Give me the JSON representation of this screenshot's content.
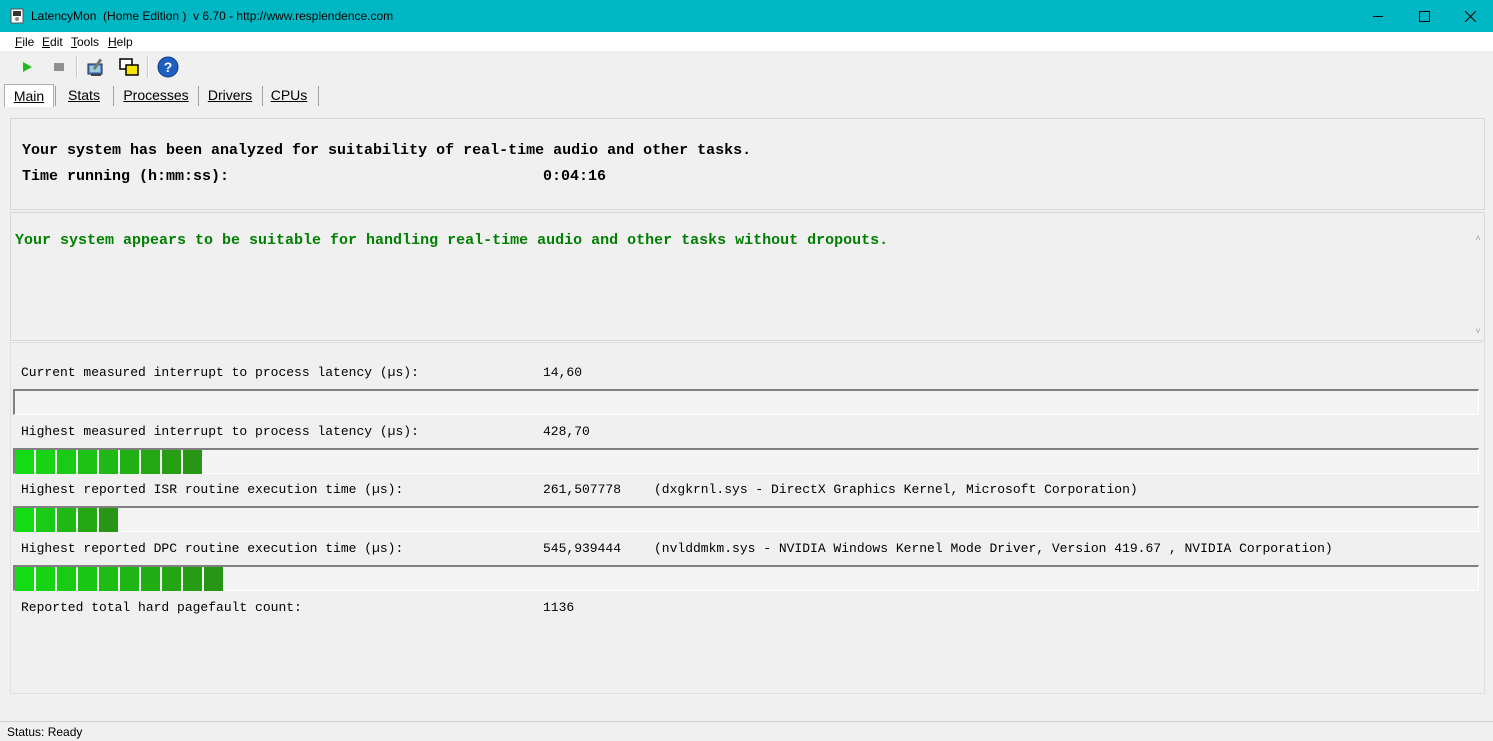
{
  "window": {
    "title": "LatencyMon  (Home Edition )  v 6.70 - http://www.resplendence.com",
    "titlebar_color": "#00b7c3"
  },
  "menu": {
    "items": [
      {
        "label": "File",
        "accel": "F",
        "rest": "ile"
      },
      {
        "label": "Edit",
        "accel": "E",
        "rest": "dit"
      },
      {
        "label": "Tools",
        "accel": "T",
        "rest": "ools"
      },
      {
        "label": "Help",
        "accel": "H",
        "rest": "elp"
      }
    ]
  },
  "toolbar": {
    "icons": [
      "play-icon",
      "stop-icon",
      "computer-tools-icon",
      "windows-overlap-icon",
      "help-icon"
    ]
  },
  "tabs": [
    {
      "label": "Main",
      "active": true
    },
    {
      "label": "Stats",
      "active": false
    },
    {
      "label": "Processes",
      "active": false
    },
    {
      "label": "Drivers",
      "active": false
    },
    {
      "label": "CPUs",
      "active": false
    }
  ],
  "summary": {
    "analyzed": "Your system has been analyzed for suitability of real-time audio and other tasks.",
    "time_label": "Time running (h:mm:ss):",
    "time_value": "0:04:16"
  },
  "conclusion": {
    "text": "Your system appears to be suitable for handling real-time audio and other tasks without dropouts.",
    "color": "#008000"
  },
  "metrics": {
    "current_latency": {
      "label": "Current measured interrupt to process latency (µs):",
      "value": "14,60",
      "segments": 0
    },
    "highest_latency": {
      "label": "Highest measured interrupt to process latency (µs):",
      "value": "428,70",
      "segments": 9
    },
    "isr": {
      "label": "Highest reported ISR routine execution time (µs):",
      "value": "261,507778",
      "detail": "(dxgkrnl.sys - DirectX Graphics Kernel, Microsoft Corporation)",
      "segments": 5
    },
    "dpc": {
      "label": "Highest reported DPC routine execution time (µs):",
      "value": "545,939444",
      "detail": "(nvlddmkm.sys - NVIDIA Windows Kernel Mode Driver, Version 419.67 , NVIDIA Corporation)",
      "segments": 10
    },
    "pagefault": {
      "label": "Reported total hard pagefault count:",
      "value": "1136"
    }
  },
  "status": {
    "text": "Status: Ready"
  }
}
